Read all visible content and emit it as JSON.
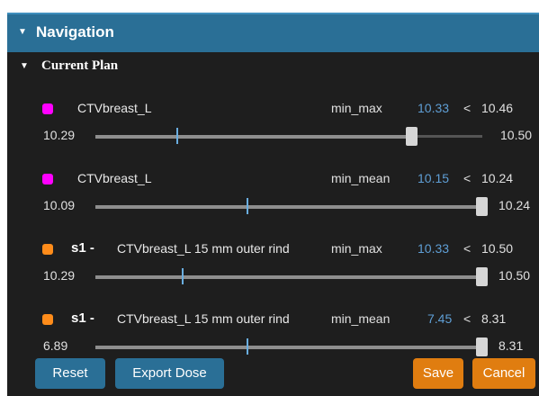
{
  "navigation": {
    "title": "Navigation"
  },
  "current_plan": {
    "title": "Current Plan"
  },
  "items": [
    {
      "color": "#ff00ff",
      "prefix": "",
      "structure": "CTVbreast_L",
      "metric": "min_max",
      "current": "10.33",
      "comparator": "<",
      "limit": "10.46",
      "min": "10.29",
      "max": "10.50",
      "fill_fraction": 0.82,
      "marker_fraction": 0.24
    },
    {
      "color": "#ff00ff",
      "prefix": "",
      "structure": "CTVbreast_L",
      "metric": "min_mean",
      "current": "10.15",
      "comparator": "<",
      "limit": "10.24",
      "min": "10.09",
      "max": "10.24",
      "fill_fraction": 1.0,
      "marker_fraction": 0.4
    },
    {
      "color": "#ff8c1a",
      "prefix": "s1 -",
      "structure": "CTVbreast_L 15 mm outer rind",
      "metric": "min_max",
      "current": "10.33",
      "comparator": "<",
      "limit": "10.50",
      "min": "10.29",
      "max": "10.50",
      "fill_fraction": 1.0,
      "marker_fraction": 0.23
    },
    {
      "color": "#ff8c1a",
      "prefix": "s1 -",
      "structure": "CTVbreast_L 15 mm outer rind",
      "metric": "min_mean",
      "current": "7.45",
      "comparator": "<",
      "limit": "8.31",
      "min": "6.89",
      "max": "8.31",
      "fill_fraction": 1.0,
      "marker_fraction": 0.39
    }
  ],
  "buttons": {
    "reset": "Reset",
    "export": "Export Dose",
    "save": "Save",
    "cancel": "Cancel"
  }
}
